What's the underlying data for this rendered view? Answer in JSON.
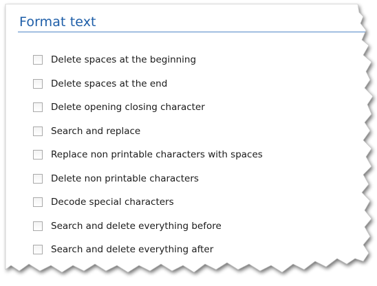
{
  "section": {
    "title": "Format text"
  },
  "options": [
    {
      "label": "Delete spaces at the beginning",
      "checked": false
    },
    {
      "label": "Delete spaces at the end",
      "checked": false
    },
    {
      "label": "Delete opening closing character",
      "checked": false
    },
    {
      "label": "Search and replace",
      "checked": false
    },
    {
      "label": "Replace non printable characters with spaces",
      "checked": false
    },
    {
      "label": "Delete non printable characters",
      "checked": false
    },
    {
      "label": "Decode special characters",
      "checked": false
    },
    {
      "label": "Search and delete everything before",
      "checked": false
    },
    {
      "label": "Search and delete everything after",
      "checked": false
    }
  ],
  "colors": {
    "title": "#1e5ea8",
    "rule": "#4f86c6",
    "checkbox_border": "#a9a9a9"
  }
}
